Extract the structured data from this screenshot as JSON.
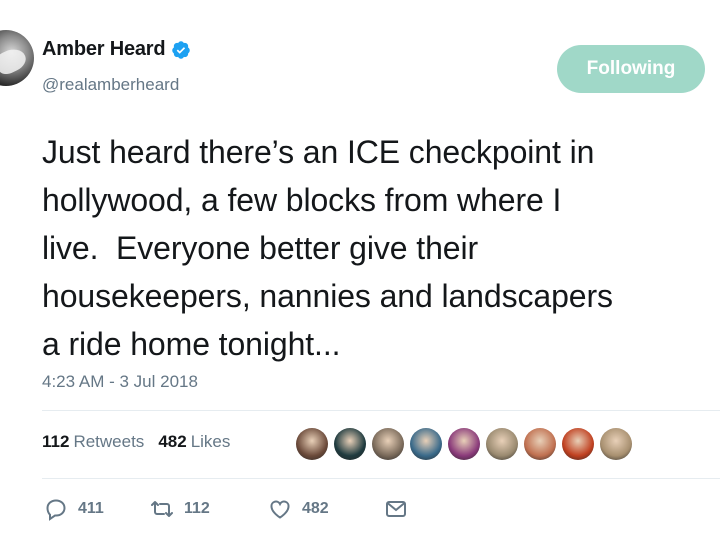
{
  "user": {
    "display_name": "Amber Heard",
    "handle": "@realamberheard",
    "verified_icon": "verified-badge-icon"
  },
  "follow_button": {
    "label": "Following",
    "color": "#a0d8c8"
  },
  "tweet": {
    "text": "Just heard there’s an ICE checkpoint in\nhollywood, a few blocks from where I\nlive.  Everyone better give their\nhousekeepers, nannies and landscapers\na ride home tonight...",
    "timestamp": "4:23 AM - 3 Jul 2018"
  },
  "stats": {
    "retweets_count": "112",
    "retweets_label": "Retweets",
    "likes_count": "482",
    "likes_label": "Likes"
  },
  "likers": [
    {
      "color": "#6b4a3a"
    },
    {
      "color": "#1f3b3f"
    },
    {
      "color": "#7a6a5a"
    },
    {
      "color": "#3a6a8a"
    },
    {
      "color": "#8a3a7a"
    },
    {
      "color": "#9a8a70"
    },
    {
      "color": "#c07050"
    },
    {
      "color": "#c04020"
    },
    {
      "color": "#a89070"
    }
  ],
  "actions": {
    "replies": "411",
    "retweets": "112",
    "likes": "482"
  },
  "colors": {
    "accent": "#1da1f2",
    "muted": "#657786",
    "text": "#14171a"
  }
}
